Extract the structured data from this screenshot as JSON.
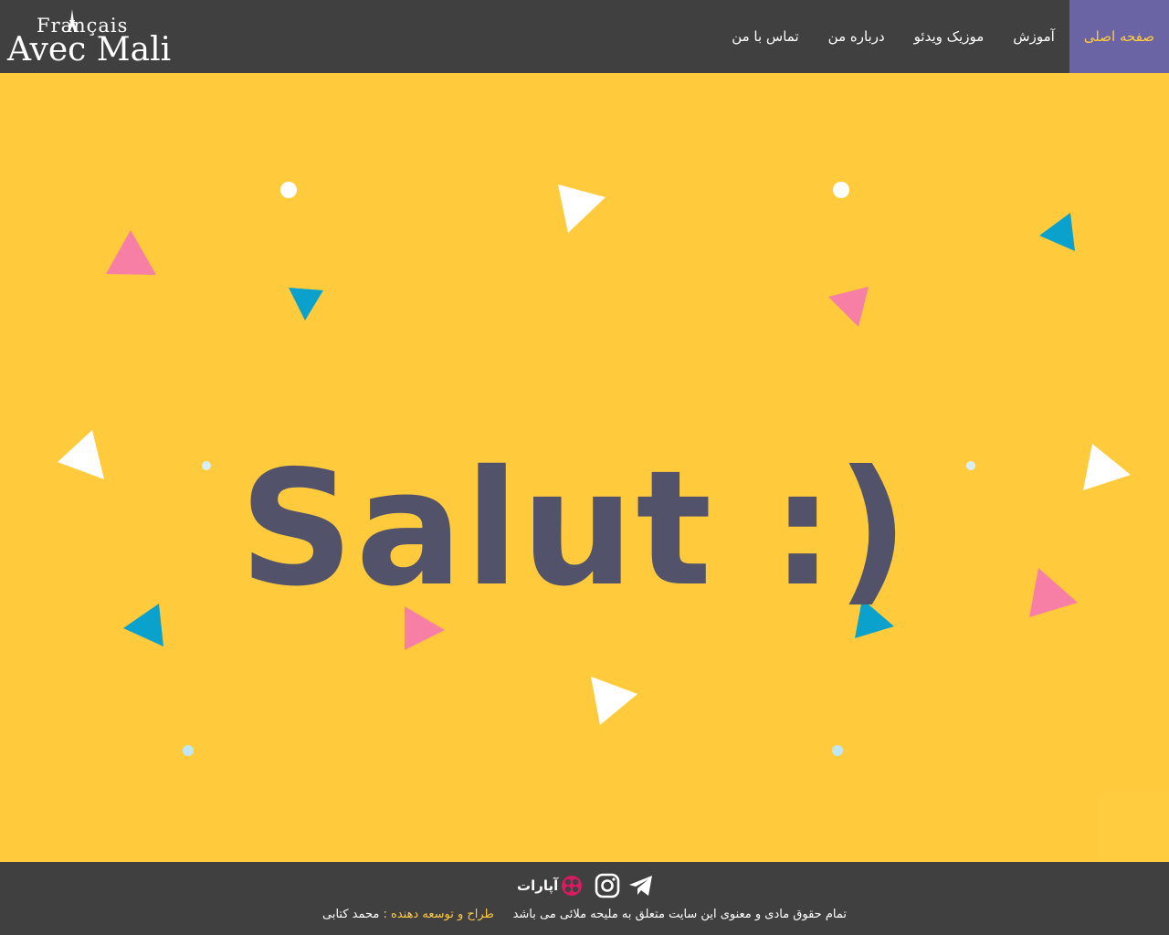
{
  "brand": {
    "logo_line1": "Français",
    "logo_line2": "Avec Mali"
  },
  "nav": {
    "items": [
      {
        "label": "صفحه اصلی",
        "active": true
      },
      {
        "label": "آموزش",
        "active": false
      },
      {
        "label": "موزیک ویدئو",
        "active": false
      },
      {
        "label": "درباره من",
        "active": false
      },
      {
        "label": "تماس با من",
        "active": false
      }
    ]
  },
  "hero": {
    "headline": "Salut :)"
  },
  "footer": {
    "aparat_label": "آپارات",
    "copyright": "تمام حقوق مادی و معنوی این سایت متعلق به ملیحه ملائی می باشد",
    "designer_prefix": "طراح و توسعه دهنده :",
    "designer_name": "محمد کتابی"
  },
  "icons": [
    "telegram-icon",
    "instagram-icon",
    "aparat-icon",
    "eiffel-tower-icon"
  ],
  "colors": {
    "header_bg": "#404040",
    "nav_active_bg": "#6b64a4",
    "accent": "#ffcb3d",
    "hero_bg": "#ffcb3d",
    "headline": "#52536b",
    "pink": "#f77fa5",
    "teal": "#0aa2cc"
  }
}
